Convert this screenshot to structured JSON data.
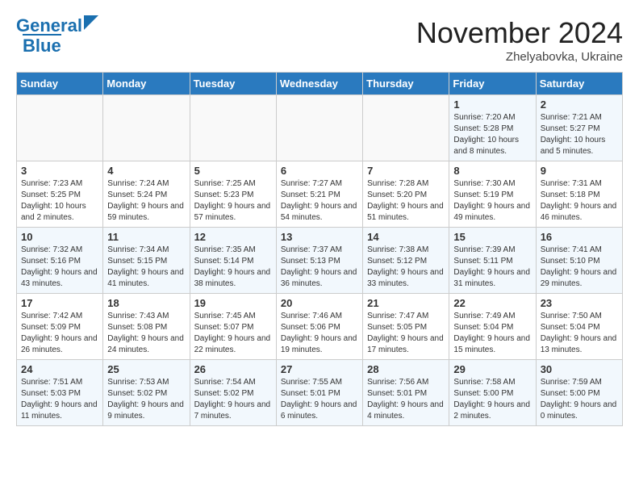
{
  "header": {
    "logo_line1": "General",
    "logo_line2": "Blue",
    "month": "November 2024",
    "location": "Zhelyabovka, Ukraine"
  },
  "weekdays": [
    "Sunday",
    "Monday",
    "Tuesday",
    "Wednesday",
    "Thursday",
    "Friday",
    "Saturday"
  ],
  "weeks": [
    [
      {
        "day": "",
        "info": ""
      },
      {
        "day": "",
        "info": ""
      },
      {
        "day": "",
        "info": ""
      },
      {
        "day": "",
        "info": ""
      },
      {
        "day": "",
        "info": ""
      },
      {
        "day": "1",
        "info": "Sunrise: 7:20 AM\nSunset: 5:28 PM\nDaylight: 10 hours and 8 minutes."
      },
      {
        "day": "2",
        "info": "Sunrise: 7:21 AM\nSunset: 5:27 PM\nDaylight: 10 hours and 5 minutes."
      }
    ],
    [
      {
        "day": "3",
        "info": "Sunrise: 7:23 AM\nSunset: 5:25 PM\nDaylight: 10 hours and 2 minutes."
      },
      {
        "day": "4",
        "info": "Sunrise: 7:24 AM\nSunset: 5:24 PM\nDaylight: 9 hours and 59 minutes."
      },
      {
        "day": "5",
        "info": "Sunrise: 7:25 AM\nSunset: 5:23 PM\nDaylight: 9 hours and 57 minutes."
      },
      {
        "day": "6",
        "info": "Sunrise: 7:27 AM\nSunset: 5:21 PM\nDaylight: 9 hours and 54 minutes."
      },
      {
        "day": "7",
        "info": "Sunrise: 7:28 AM\nSunset: 5:20 PM\nDaylight: 9 hours and 51 minutes."
      },
      {
        "day": "8",
        "info": "Sunrise: 7:30 AM\nSunset: 5:19 PM\nDaylight: 9 hours and 49 minutes."
      },
      {
        "day": "9",
        "info": "Sunrise: 7:31 AM\nSunset: 5:18 PM\nDaylight: 9 hours and 46 minutes."
      }
    ],
    [
      {
        "day": "10",
        "info": "Sunrise: 7:32 AM\nSunset: 5:16 PM\nDaylight: 9 hours and 43 minutes."
      },
      {
        "day": "11",
        "info": "Sunrise: 7:34 AM\nSunset: 5:15 PM\nDaylight: 9 hours and 41 minutes."
      },
      {
        "day": "12",
        "info": "Sunrise: 7:35 AM\nSunset: 5:14 PM\nDaylight: 9 hours and 38 minutes."
      },
      {
        "day": "13",
        "info": "Sunrise: 7:37 AM\nSunset: 5:13 PM\nDaylight: 9 hours and 36 minutes."
      },
      {
        "day": "14",
        "info": "Sunrise: 7:38 AM\nSunset: 5:12 PM\nDaylight: 9 hours and 33 minutes."
      },
      {
        "day": "15",
        "info": "Sunrise: 7:39 AM\nSunset: 5:11 PM\nDaylight: 9 hours and 31 minutes."
      },
      {
        "day": "16",
        "info": "Sunrise: 7:41 AM\nSunset: 5:10 PM\nDaylight: 9 hours and 29 minutes."
      }
    ],
    [
      {
        "day": "17",
        "info": "Sunrise: 7:42 AM\nSunset: 5:09 PM\nDaylight: 9 hours and 26 minutes."
      },
      {
        "day": "18",
        "info": "Sunrise: 7:43 AM\nSunset: 5:08 PM\nDaylight: 9 hours and 24 minutes."
      },
      {
        "day": "19",
        "info": "Sunrise: 7:45 AM\nSunset: 5:07 PM\nDaylight: 9 hours and 22 minutes."
      },
      {
        "day": "20",
        "info": "Sunrise: 7:46 AM\nSunset: 5:06 PM\nDaylight: 9 hours and 19 minutes."
      },
      {
        "day": "21",
        "info": "Sunrise: 7:47 AM\nSunset: 5:05 PM\nDaylight: 9 hours and 17 minutes."
      },
      {
        "day": "22",
        "info": "Sunrise: 7:49 AM\nSunset: 5:04 PM\nDaylight: 9 hours and 15 minutes."
      },
      {
        "day": "23",
        "info": "Sunrise: 7:50 AM\nSunset: 5:04 PM\nDaylight: 9 hours and 13 minutes."
      }
    ],
    [
      {
        "day": "24",
        "info": "Sunrise: 7:51 AM\nSunset: 5:03 PM\nDaylight: 9 hours and 11 minutes."
      },
      {
        "day": "25",
        "info": "Sunrise: 7:53 AM\nSunset: 5:02 PM\nDaylight: 9 hours and 9 minutes."
      },
      {
        "day": "26",
        "info": "Sunrise: 7:54 AM\nSunset: 5:02 PM\nDaylight: 9 hours and 7 minutes."
      },
      {
        "day": "27",
        "info": "Sunrise: 7:55 AM\nSunset: 5:01 PM\nDaylight: 9 hours and 6 minutes."
      },
      {
        "day": "28",
        "info": "Sunrise: 7:56 AM\nSunset: 5:01 PM\nDaylight: 9 hours and 4 minutes."
      },
      {
        "day": "29",
        "info": "Sunrise: 7:58 AM\nSunset: 5:00 PM\nDaylight: 9 hours and 2 minutes."
      },
      {
        "day": "30",
        "info": "Sunrise: 7:59 AM\nSunset: 5:00 PM\nDaylight: 9 hours and 0 minutes."
      }
    ]
  ]
}
